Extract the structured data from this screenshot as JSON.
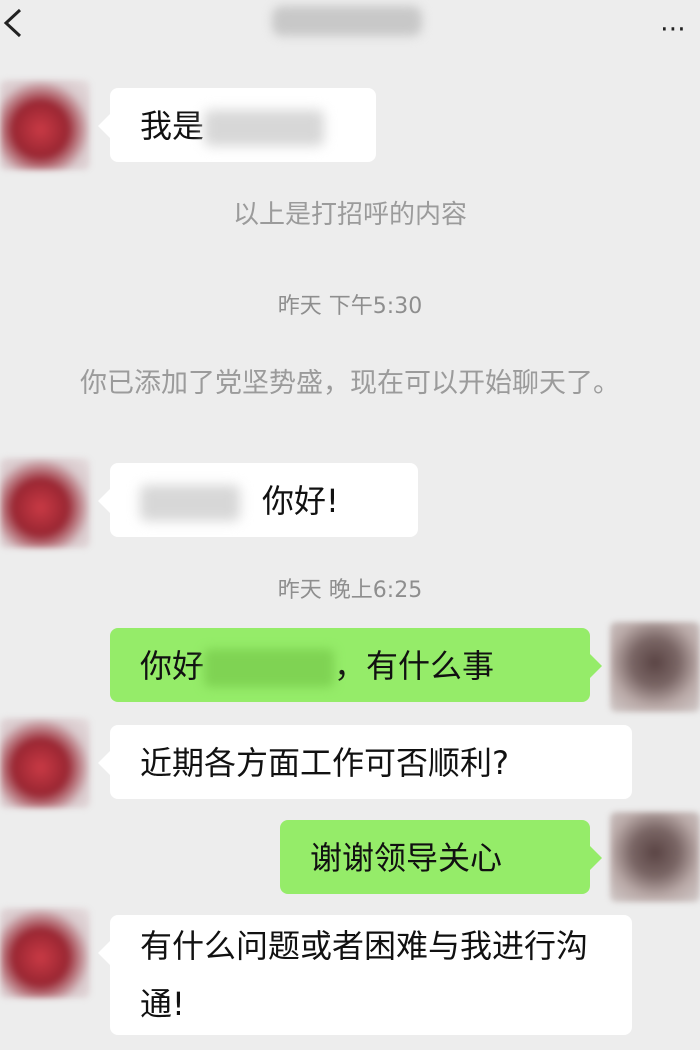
{
  "header": {
    "title": "",
    "more_label": "⋯"
  },
  "messages": {
    "m1": {
      "prefix": "我是"
    },
    "system_greeting": "以上是打招呼的内容",
    "time1": "昨天 下午5:30",
    "system_added": "你已添加了党坚势盛，现在可以开始聊天了。",
    "m2": {
      "text": "你好!"
    },
    "time2": "昨天 晚上6:25",
    "m3": {
      "prefix": "你好",
      "suffix": "，有什么事"
    },
    "m4": {
      "text": "近期各方面工作可否顺利?"
    },
    "m5": {
      "text": "谢谢领导关心"
    },
    "m6": {
      "text": "有什么问题或者困难与我进行沟通!"
    }
  },
  "colors": {
    "background": "#ededed",
    "incoming_bubble": "#ffffff",
    "outgoing_bubble": "#95ec69"
  },
  "icons": {
    "back": "chevron-left-icon",
    "more": "more-dots-icon"
  }
}
